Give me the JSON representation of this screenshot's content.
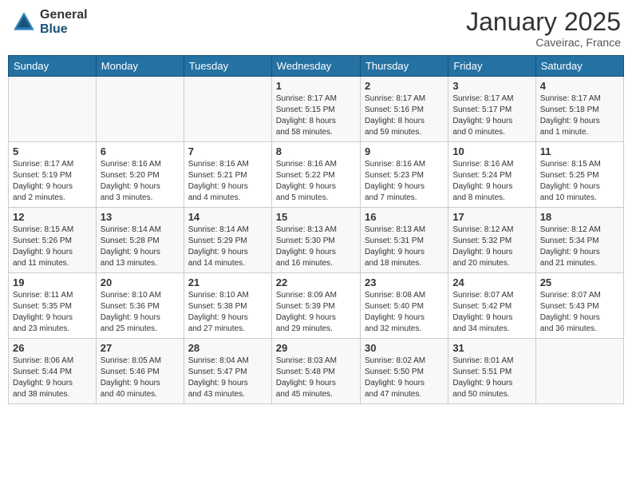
{
  "logo": {
    "general": "General",
    "blue": "Blue"
  },
  "header": {
    "month": "January 2025",
    "location": "Caveirac, France"
  },
  "weekdays": [
    "Sunday",
    "Monday",
    "Tuesday",
    "Wednesday",
    "Thursday",
    "Friday",
    "Saturday"
  ],
  "weeks": [
    [
      {
        "day": "",
        "info": ""
      },
      {
        "day": "",
        "info": ""
      },
      {
        "day": "",
        "info": ""
      },
      {
        "day": "1",
        "info": "Sunrise: 8:17 AM\nSunset: 5:15 PM\nDaylight: 8 hours\nand 58 minutes."
      },
      {
        "day": "2",
        "info": "Sunrise: 8:17 AM\nSunset: 5:16 PM\nDaylight: 8 hours\nand 59 minutes."
      },
      {
        "day": "3",
        "info": "Sunrise: 8:17 AM\nSunset: 5:17 PM\nDaylight: 9 hours\nand 0 minutes."
      },
      {
        "day": "4",
        "info": "Sunrise: 8:17 AM\nSunset: 5:18 PM\nDaylight: 9 hours\nand 1 minute."
      }
    ],
    [
      {
        "day": "5",
        "info": "Sunrise: 8:17 AM\nSunset: 5:19 PM\nDaylight: 9 hours\nand 2 minutes."
      },
      {
        "day": "6",
        "info": "Sunrise: 8:16 AM\nSunset: 5:20 PM\nDaylight: 9 hours\nand 3 minutes."
      },
      {
        "day": "7",
        "info": "Sunrise: 8:16 AM\nSunset: 5:21 PM\nDaylight: 9 hours\nand 4 minutes."
      },
      {
        "day": "8",
        "info": "Sunrise: 8:16 AM\nSunset: 5:22 PM\nDaylight: 9 hours\nand 5 minutes."
      },
      {
        "day": "9",
        "info": "Sunrise: 8:16 AM\nSunset: 5:23 PM\nDaylight: 9 hours\nand 7 minutes."
      },
      {
        "day": "10",
        "info": "Sunrise: 8:16 AM\nSunset: 5:24 PM\nDaylight: 9 hours\nand 8 minutes."
      },
      {
        "day": "11",
        "info": "Sunrise: 8:15 AM\nSunset: 5:25 PM\nDaylight: 9 hours\nand 10 minutes."
      }
    ],
    [
      {
        "day": "12",
        "info": "Sunrise: 8:15 AM\nSunset: 5:26 PM\nDaylight: 9 hours\nand 11 minutes."
      },
      {
        "day": "13",
        "info": "Sunrise: 8:14 AM\nSunset: 5:28 PM\nDaylight: 9 hours\nand 13 minutes."
      },
      {
        "day": "14",
        "info": "Sunrise: 8:14 AM\nSunset: 5:29 PM\nDaylight: 9 hours\nand 14 minutes."
      },
      {
        "day": "15",
        "info": "Sunrise: 8:13 AM\nSunset: 5:30 PM\nDaylight: 9 hours\nand 16 minutes."
      },
      {
        "day": "16",
        "info": "Sunrise: 8:13 AM\nSunset: 5:31 PM\nDaylight: 9 hours\nand 18 minutes."
      },
      {
        "day": "17",
        "info": "Sunrise: 8:12 AM\nSunset: 5:32 PM\nDaylight: 9 hours\nand 20 minutes."
      },
      {
        "day": "18",
        "info": "Sunrise: 8:12 AM\nSunset: 5:34 PM\nDaylight: 9 hours\nand 21 minutes."
      }
    ],
    [
      {
        "day": "19",
        "info": "Sunrise: 8:11 AM\nSunset: 5:35 PM\nDaylight: 9 hours\nand 23 minutes."
      },
      {
        "day": "20",
        "info": "Sunrise: 8:10 AM\nSunset: 5:36 PM\nDaylight: 9 hours\nand 25 minutes."
      },
      {
        "day": "21",
        "info": "Sunrise: 8:10 AM\nSunset: 5:38 PM\nDaylight: 9 hours\nand 27 minutes."
      },
      {
        "day": "22",
        "info": "Sunrise: 8:09 AM\nSunset: 5:39 PM\nDaylight: 9 hours\nand 29 minutes."
      },
      {
        "day": "23",
        "info": "Sunrise: 8:08 AM\nSunset: 5:40 PM\nDaylight: 9 hours\nand 32 minutes."
      },
      {
        "day": "24",
        "info": "Sunrise: 8:07 AM\nSunset: 5:42 PM\nDaylight: 9 hours\nand 34 minutes."
      },
      {
        "day": "25",
        "info": "Sunrise: 8:07 AM\nSunset: 5:43 PM\nDaylight: 9 hours\nand 36 minutes."
      }
    ],
    [
      {
        "day": "26",
        "info": "Sunrise: 8:06 AM\nSunset: 5:44 PM\nDaylight: 9 hours\nand 38 minutes."
      },
      {
        "day": "27",
        "info": "Sunrise: 8:05 AM\nSunset: 5:46 PM\nDaylight: 9 hours\nand 40 minutes."
      },
      {
        "day": "28",
        "info": "Sunrise: 8:04 AM\nSunset: 5:47 PM\nDaylight: 9 hours\nand 43 minutes."
      },
      {
        "day": "29",
        "info": "Sunrise: 8:03 AM\nSunset: 5:48 PM\nDaylight: 9 hours\nand 45 minutes."
      },
      {
        "day": "30",
        "info": "Sunrise: 8:02 AM\nSunset: 5:50 PM\nDaylight: 9 hours\nand 47 minutes."
      },
      {
        "day": "31",
        "info": "Sunrise: 8:01 AM\nSunset: 5:51 PM\nDaylight: 9 hours\nand 50 minutes."
      },
      {
        "day": "",
        "info": ""
      }
    ]
  ]
}
